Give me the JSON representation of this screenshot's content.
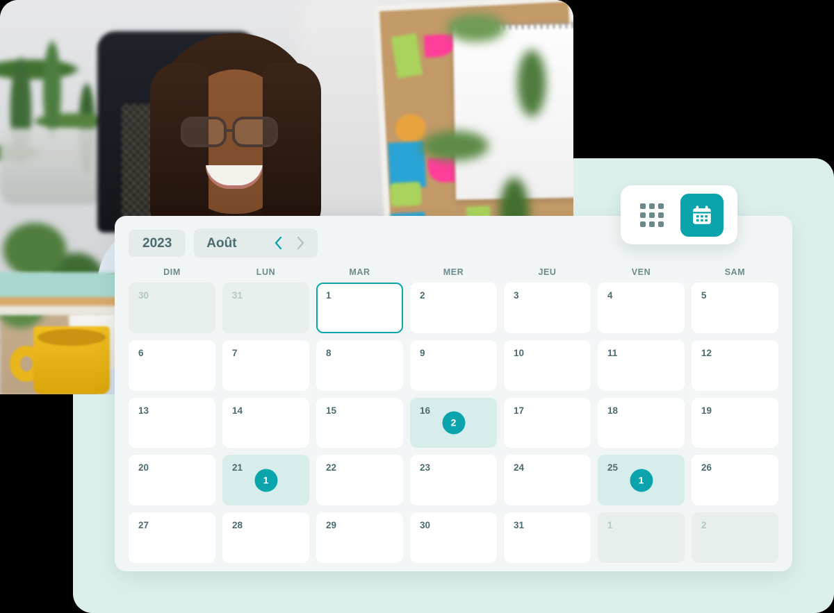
{
  "photo": {
    "alt_description": "Smiling woman with glasses celebrating at an office desk with plants, a cork board and a yellow mug",
    "name": "hero-photo"
  },
  "calendar": {
    "year": "2023",
    "month": "Août",
    "prev_label": "‹",
    "next_label": "›",
    "weekdays": [
      "DIM",
      "LUN",
      "MAR",
      "MER",
      "JEU",
      "VEN",
      "SAM"
    ],
    "weeks": [
      [
        {
          "day": "30",
          "state": "muted",
          "badge": null
        },
        {
          "day": "31",
          "state": "muted",
          "badge": null
        },
        {
          "day": "1",
          "state": "selected",
          "badge": null
        },
        {
          "day": "2",
          "state": "normal",
          "badge": null
        },
        {
          "day": "3",
          "state": "normal",
          "badge": null
        },
        {
          "day": "4",
          "state": "normal",
          "badge": null
        },
        {
          "day": "5",
          "state": "normal",
          "badge": null
        }
      ],
      [
        {
          "day": "6",
          "state": "normal",
          "badge": null
        },
        {
          "day": "7",
          "state": "normal",
          "badge": null
        },
        {
          "day": "8",
          "state": "normal",
          "badge": null
        },
        {
          "day": "9",
          "state": "normal",
          "badge": null
        },
        {
          "day": "10",
          "state": "normal",
          "badge": null
        },
        {
          "day": "11",
          "state": "normal",
          "badge": null
        },
        {
          "day": "12",
          "state": "normal",
          "badge": null
        }
      ],
      [
        {
          "day": "13",
          "state": "normal",
          "badge": null
        },
        {
          "day": "14",
          "state": "normal",
          "badge": null
        },
        {
          "day": "15",
          "state": "normal",
          "badge": null
        },
        {
          "day": "16",
          "state": "has-events",
          "badge": "2"
        },
        {
          "day": "17",
          "state": "normal",
          "badge": null
        },
        {
          "day": "18",
          "state": "normal",
          "badge": null
        },
        {
          "day": "19",
          "state": "normal",
          "badge": null
        }
      ],
      [
        {
          "day": "20",
          "state": "normal",
          "badge": null
        },
        {
          "day": "21",
          "state": "has-events",
          "badge": "1"
        },
        {
          "day": "22",
          "state": "normal",
          "badge": null
        },
        {
          "day": "23",
          "state": "normal",
          "badge": null
        },
        {
          "day": "24",
          "state": "normal",
          "badge": null
        },
        {
          "day": "25",
          "state": "has-events",
          "badge": "1"
        },
        {
          "day": "26",
          "state": "normal",
          "badge": null
        }
      ],
      [
        {
          "day": "27",
          "state": "normal",
          "badge": null
        },
        {
          "day": "28",
          "state": "normal",
          "badge": null
        },
        {
          "day": "29",
          "state": "normal",
          "badge": null
        },
        {
          "day": "30",
          "state": "normal",
          "badge": null
        },
        {
          "day": "31",
          "state": "normal",
          "badge": null
        },
        {
          "day": "1",
          "state": "muted",
          "badge": null
        },
        {
          "day": "2",
          "state": "muted",
          "badge": null
        }
      ]
    ]
  },
  "view_toggle": {
    "grid_view_name": "grid-view-icon",
    "calendar_view_name": "calendar-view-icon",
    "active": "calendar"
  },
  "colors": {
    "accent": "#0ba3ac",
    "accent_soft": "#d6edeb",
    "panel_back": "#dcefed",
    "card_bg": "#f1f5f5",
    "muted_cell": "#e7eeec",
    "text": "#4c6b70",
    "text_muted": "#b2c6c4"
  }
}
